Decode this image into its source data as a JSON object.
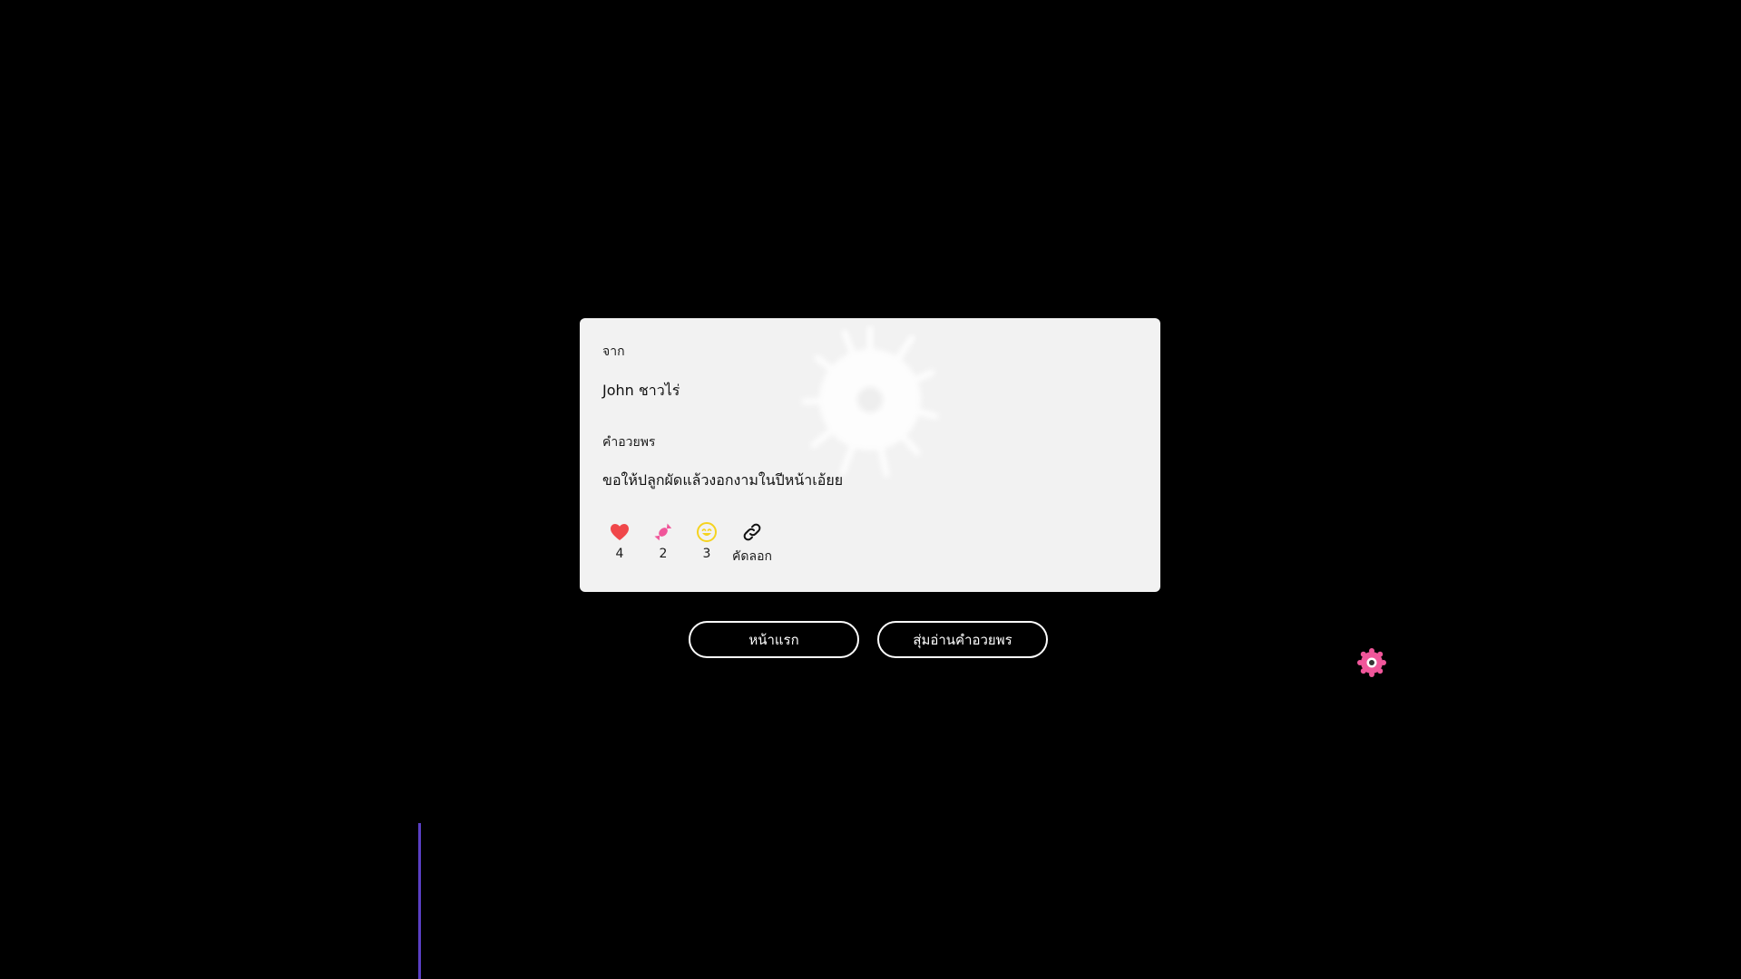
{
  "card": {
    "from_label": "จาก",
    "from_name": "John ชาวไร่",
    "blessing_label": "คำอวยพร",
    "blessing_text": "ขอให้ปลูกผัดแล้วงอกงามในปีหน้าเอ้ยย",
    "reactions": [
      {
        "icon": "heart-icon",
        "count": "4",
        "color": "#f0474a"
      },
      {
        "icon": "candy-icon",
        "count": "2",
        "color": "#f0569a"
      },
      {
        "icon": "smile-icon",
        "count": "3",
        "color": "#f5d320"
      },
      {
        "icon": "link-icon",
        "label": "คัดลอก",
        "color": "#111111"
      }
    ]
  },
  "buttons": {
    "home_label": "หน้าแรก",
    "random_label": "สุ่มอ่านคำอวยพร"
  },
  "colors": {
    "background": "#000000",
    "card": "#f2f2f2",
    "accent_pink": "#f0569a",
    "accent_purple": "#5a3fc4"
  }
}
